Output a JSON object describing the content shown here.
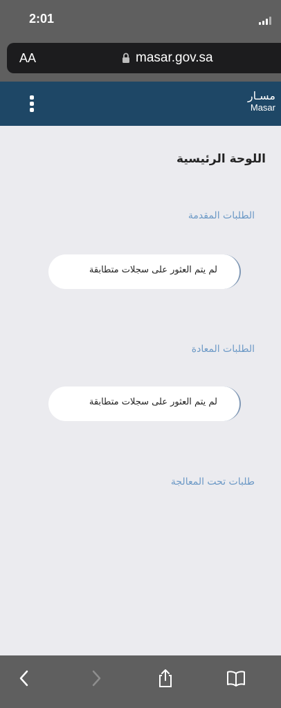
{
  "status": {
    "time": "2:01"
  },
  "browser": {
    "aa_label": "AA",
    "url": "masar.gov.sa"
  },
  "header": {
    "brand_ar": "مسـار",
    "brand_en": "Masar"
  },
  "main": {
    "page_title": "اللوحة الرئيسية",
    "sections": [
      {
        "title": "الطلبات المقدمة",
        "empty_message": "لم يتم العثور على سجلات متطابقة"
      },
      {
        "title": "الطلبات المعادة",
        "empty_message": "لم يتم العثور على سجلات متطابقة"
      },
      {
        "title": "طلبات تحت المعالجة"
      }
    ]
  },
  "toolbar": {
    "icons": [
      "back-icon",
      "forward-icon",
      "share-icon",
      "bookmarks-icon"
    ]
  }
}
